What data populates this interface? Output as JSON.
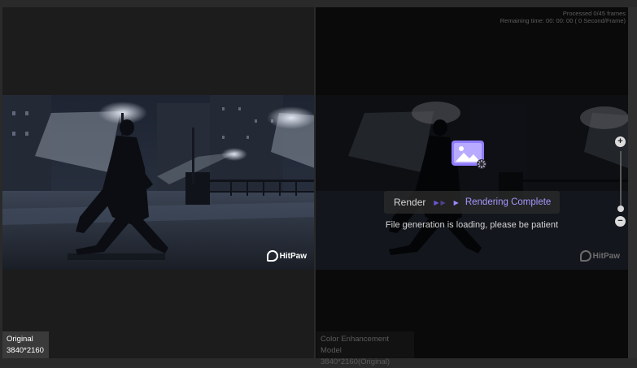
{
  "left_badge": {
    "label": "Original",
    "resolution": "3840*2160"
  },
  "right_badge": {
    "label": "Color Enhancement Model",
    "resolution": "3840*2160(Original)"
  },
  "progress": {
    "processed": "Processed 0/45 frames",
    "remaining": "Remaining time: 00: 00: 00 ( 0 Second/Frame)"
  },
  "render": {
    "label": "Render",
    "status": "Rendering Complete",
    "message": "File generation is loading, please be patient"
  },
  "watermark": {
    "text": "HitPaw"
  },
  "zoom": {
    "plus_icon": "plus-icon",
    "minus_icon": "minus-icon",
    "level": 0.85
  },
  "colors": {
    "accent": "#a497ff",
    "render_icon": "#8f7cff"
  }
}
